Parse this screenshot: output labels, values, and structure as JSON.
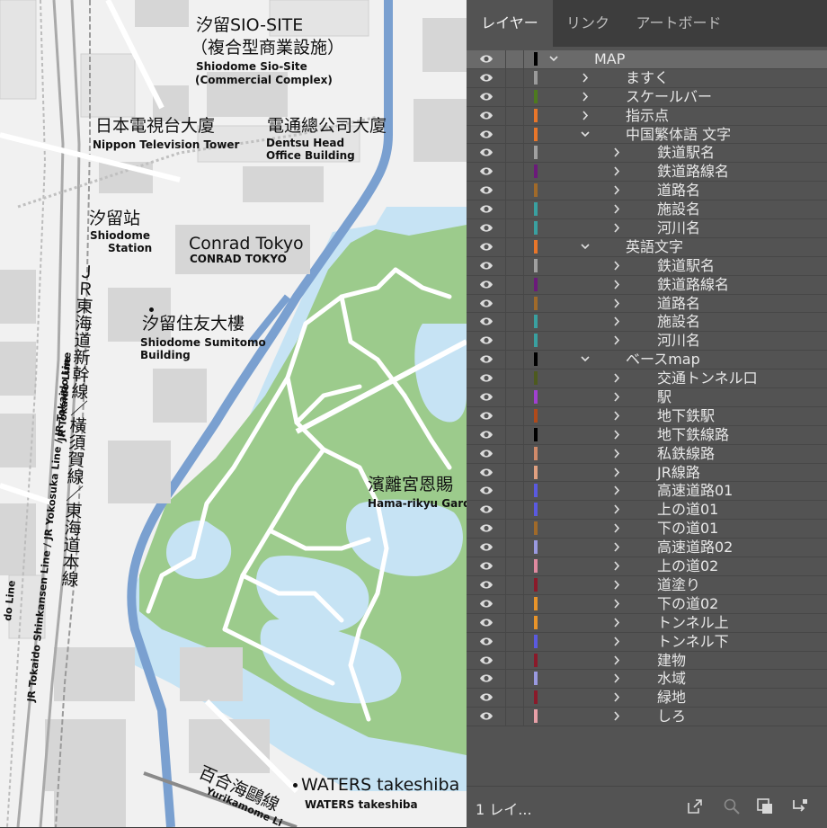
{
  "map": {
    "labels": {
      "sio_site_ja": "汐留SIO-SITE",
      "sio_site_ja2": "（複合型商業設施）",
      "sio_site_en": "Shiodome Sio-Site",
      "sio_site_en2": "(Commercial Complex)",
      "ntv_ja": "日本電視台大廈",
      "ntv_en": "Nippon Television Tower",
      "dentsu_ja": "電通總公司大廈",
      "dentsu_en": "Dentsu Head",
      "dentsu_en2": "Office Building",
      "shiodome_st_ja": "汐留站",
      "shiodome_st_en": "Shiodome",
      "shiodome_st_en2": "Station",
      "conrad_ja": "Conrad Tokyo",
      "conrad_en": "CONRAD TOKYO",
      "sumitomo_ja": "汐留住友大樓",
      "sumitomo_en": "Shiodome Sumitomo",
      "sumitomo_en2": "Building",
      "hama_ja": "濱離宮恩賜",
      "hama_en": "Hama-rikyu Garde",
      "waters_ja": "WATERS takeshiba",
      "waters_en": "WATERS takeshiba",
      "yurikamome_ja": "百合海鷗線",
      "yurikamome_en": "Yurikamome Li",
      "jr_tokaido_vert": "ＪＲ東海道新幹線／橫須賀線／東海道本線",
      "jr_tokaido_line_en": "JR Tokaido Line",
      "jr_lines_en": "JR Tokaido Shinkansen Line / JR Yokosuka Line / JR Tokaido Line",
      "do_line_en": "do Line"
    }
  },
  "panel": {
    "tabs": [
      {
        "label": "レイヤー",
        "active": true
      },
      {
        "label": "リンク",
        "active": false
      },
      {
        "label": "アートボード",
        "active": false
      }
    ],
    "layers": [
      {
        "name": "MAP",
        "level": 0,
        "expanded": true,
        "color": "#000000",
        "selected": true
      },
      {
        "name": "ますく",
        "level": 1,
        "expanded": false,
        "color": "#9a9a9a"
      },
      {
        "name": "スケールバー",
        "level": 1,
        "expanded": false,
        "color": "#4d7a1e"
      },
      {
        "name": "指示点",
        "level": 1,
        "expanded": false,
        "color": "#e8762a"
      },
      {
        "name": "中国繁体語 文字",
        "level": 1,
        "expanded": true,
        "color": "#e8762a"
      },
      {
        "name": "鉄道駅名",
        "level": 2,
        "expanded": false,
        "color": "#a0a0a0"
      },
      {
        "name": "鉄道路線名",
        "level": 2,
        "expanded": false,
        "color": "#6b1a7a"
      },
      {
        "name": "道路名",
        "level": 2,
        "expanded": false,
        "color": "#a06a2a"
      },
      {
        "name": "施設名",
        "level": 2,
        "expanded": false,
        "color": "#3aa0a0"
      },
      {
        "name": "河川名",
        "level": 2,
        "expanded": false,
        "color": "#3aa0a0"
      },
      {
        "name": "英語文字",
        "level": 1,
        "expanded": true,
        "color": "#e8762a"
      },
      {
        "name": "鉄道駅名",
        "level": 2,
        "expanded": false,
        "color": "#a0a0a0"
      },
      {
        "name": "鉄道路線名",
        "level": 2,
        "expanded": false,
        "color": "#6b1a7a"
      },
      {
        "name": "道路名",
        "level": 2,
        "expanded": false,
        "color": "#a06a2a"
      },
      {
        "name": "施設名",
        "level": 2,
        "expanded": false,
        "color": "#3aa0a0"
      },
      {
        "name": "河川名",
        "level": 2,
        "expanded": false,
        "color": "#3aa0a0"
      },
      {
        "name": "ベースmap",
        "level": 1,
        "expanded": true,
        "color": "#000000"
      },
      {
        "name": "交通トンネル口",
        "level": 2,
        "expanded": false,
        "color": "#4d5a1e"
      },
      {
        "name": "駅",
        "level": 2,
        "expanded": false,
        "color": "#a040d0"
      },
      {
        "name": "地下鉄駅",
        "level": 2,
        "expanded": false,
        "color": "#b04a1a"
      },
      {
        "name": "地下鉄線路",
        "level": 2,
        "expanded": false,
        "color": "#000000"
      },
      {
        "name": "私鉄線路",
        "level": 2,
        "expanded": false,
        "color": "#d08a6a"
      },
      {
        "name": "JR線路",
        "level": 2,
        "expanded": false,
        "color": "#e0a080"
      },
      {
        "name": "高速道路01",
        "level": 2,
        "expanded": false,
        "color": "#5a5ae0"
      },
      {
        "name": "上の道01",
        "level": 2,
        "expanded": false,
        "color": "#5a5ae0"
      },
      {
        "name": "下の道01",
        "level": 2,
        "expanded": false,
        "color": "#a06a2a"
      },
      {
        "name": "高速道路02",
        "level": 2,
        "expanded": false,
        "color": "#9a9ae0"
      },
      {
        "name": "上の道02",
        "level": 2,
        "expanded": false,
        "color": "#e08aa0"
      },
      {
        "name": "道塗り",
        "level": 2,
        "expanded": false,
        "color": "#8a1a2a"
      },
      {
        "name": "下の道02",
        "level": 2,
        "expanded": false,
        "color": "#e8942a"
      },
      {
        "name": "トンネル上",
        "level": 2,
        "expanded": false,
        "color": "#e8942a"
      },
      {
        "name": "トンネル下",
        "level": 2,
        "expanded": false,
        "color": "#5a5ae0"
      },
      {
        "name": "建物",
        "level": 2,
        "expanded": false,
        "color": "#8a1a2a"
      },
      {
        "name": "水域",
        "level": 2,
        "expanded": false,
        "color": "#9a9ae0"
      },
      {
        "name": "緑地",
        "level": 2,
        "expanded": false,
        "color": "#8a1a2a"
      },
      {
        "name": "しろ",
        "level": 2,
        "expanded": false,
        "color": "#e8a0a8"
      }
    ],
    "footer": {
      "count": "1 レイ...",
      "icons": [
        "export-icon",
        "locate-object-icon",
        "make-clipping-mask-icon",
        "new-sublayer-icon"
      ]
    }
  }
}
